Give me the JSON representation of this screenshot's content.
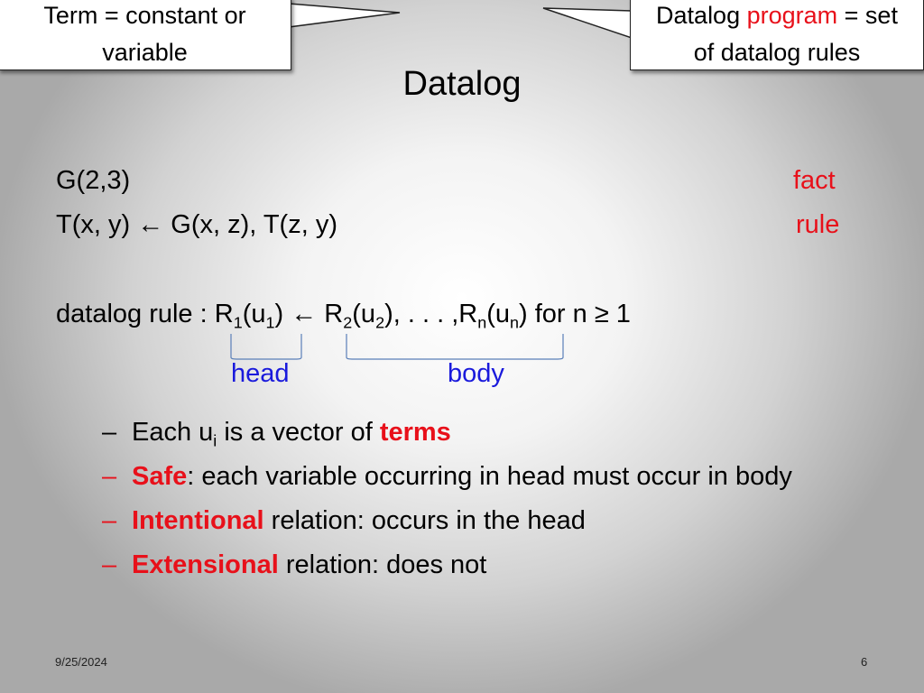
{
  "callouts": {
    "left": {
      "line1": "Term = constant or",
      "line2": "variable"
    },
    "right": {
      "line1_pre": "Datalog ",
      "line1_red": "program",
      "line1_post": " = set",
      "line2": "of datalog rules"
    }
  },
  "slide": {
    "title": "Datalog",
    "fact_example": "G(2,3)",
    "fact_label": "fact",
    "rule_example": "T(x, y) ← G(x, z), T(z, y)",
    "rule_label": "rule",
    "definition": {
      "prefix": "datalog rule : ",
      "R": "R",
      "u": "u",
      "s1": "1",
      "s2": "2",
      "sn": "n",
      "open": "(",
      "close": ")",
      "arrow": " ← ",
      "middle": ", . . . ,",
      "suffix": " for n ≥ 1"
    },
    "head_label": "head",
    "body_label": "body",
    "bullets": [
      {
        "pre": "Each u",
        "sub": "i",
        "mid": " is a vector of ",
        "highlight": "terms",
        "post": ""
      },
      {
        "highlight": "Safe",
        "post": ": each variable occurring in head must occur in body"
      },
      {
        "highlight": "Intentional",
        "post": " relation: occurs in the head"
      },
      {
        "highlight": "Extensional",
        "post": " relation: does not"
      }
    ],
    "bullet_dash": "–"
  },
  "footer": {
    "date": "9/25/2024",
    "page": "6"
  },
  "colors": {
    "accent_red": "#e8101a",
    "accent_blue": "#1a1adc"
  }
}
